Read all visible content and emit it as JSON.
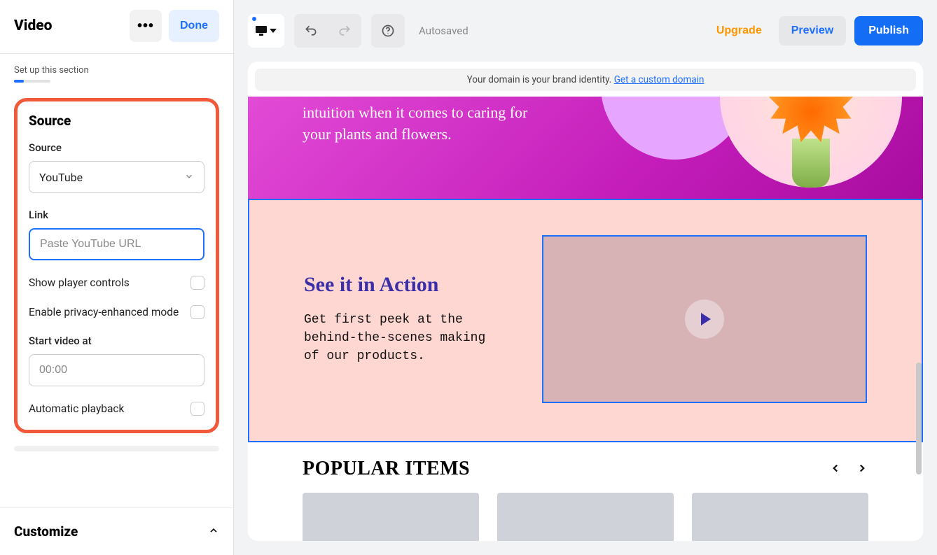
{
  "sidebar": {
    "title": "Video",
    "done_label": "Done",
    "setup_label": "Set up this section",
    "panel_heading": "Source",
    "source_label": "Source",
    "source_value": "YouTube",
    "link_label": "Link",
    "link_placeholder": "Paste YouTube URL",
    "show_controls_label": "Show player controls",
    "privacy_label": "Enable privacy-enhanced mode",
    "start_label": "Start video at",
    "start_placeholder": "00:00",
    "auto_label": "Automatic playback",
    "customize_label": "Customize"
  },
  "topbar": {
    "autosaved": "Autosaved",
    "upgrade": "Upgrade",
    "preview": "Preview",
    "publish": "Publish"
  },
  "banner": {
    "text": "Your domain is your brand identity. ",
    "link": "Get a custom domain"
  },
  "hero": {
    "text": "intuition when it comes to caring for your plants and flowers."
  },
  "video": {
    "title": "See it in Action",
    "desc": "Get first peek at the behind-the-scenes making of our products."
  },
  "popular": {
    "title": "POPULAR ITEMS"
  }
}
